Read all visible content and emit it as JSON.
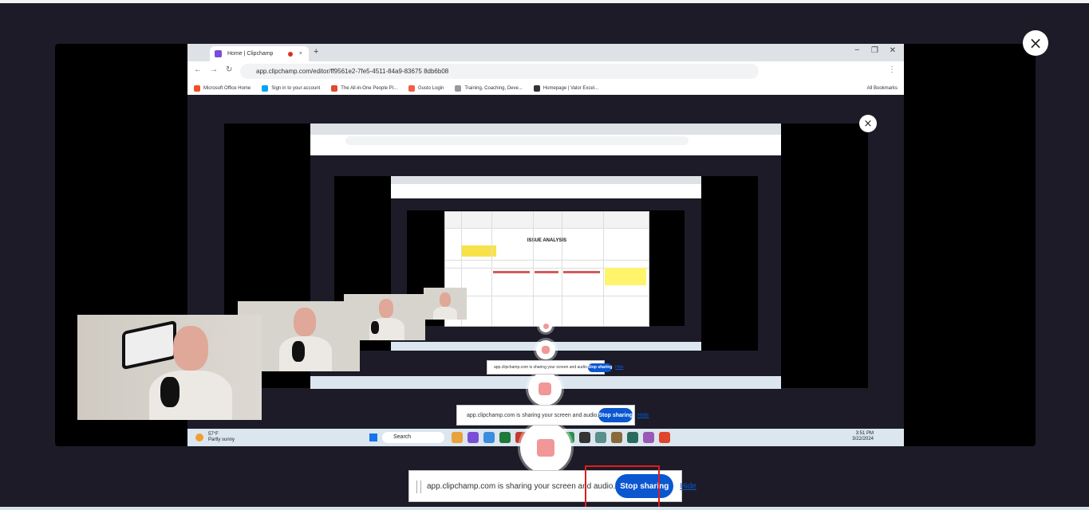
{
  "modal": {
    "close_symbol": "×"
  },
  "browser": {
    "tab_title": "Home | Clipchamp",
    "url": "app.clipchamp.com/editor/ff9561e2-7fe5-4511-84a9-83675 8db6b08",
    "bookmarks": [
      "Microsoft Office Home",
      "Sign in to your account",
      "The All-in-One People Pl...",
      "Gusto Login",
      "Training, Coaching, Deve...",
      "Homepage | Valor Excel..."
    ],
    "all_bookmarks": "All Bookmarks"
  },
  "taskbar": {
    "weather_temp": "57°F",
    "weather_text": "Partly sunny",
    "search_label": "Search",
    "time": "3:51 PM",
    "date": "3/22/2024"
  },
  "spreadsheet": {
    "title": "ISSUE ANALYSIS"
  },
  "share_bar": {
    "message": "app.clipchamp.com is sharing your screen and audio.",
    "stop_label": "Stop sharing",
    "hide_label": "Hide"
  },
  "colors": {
    "accent": "#0b57d0",
    "highlight": "#e01c1c",
    "record": "#f19797"
  }
}
